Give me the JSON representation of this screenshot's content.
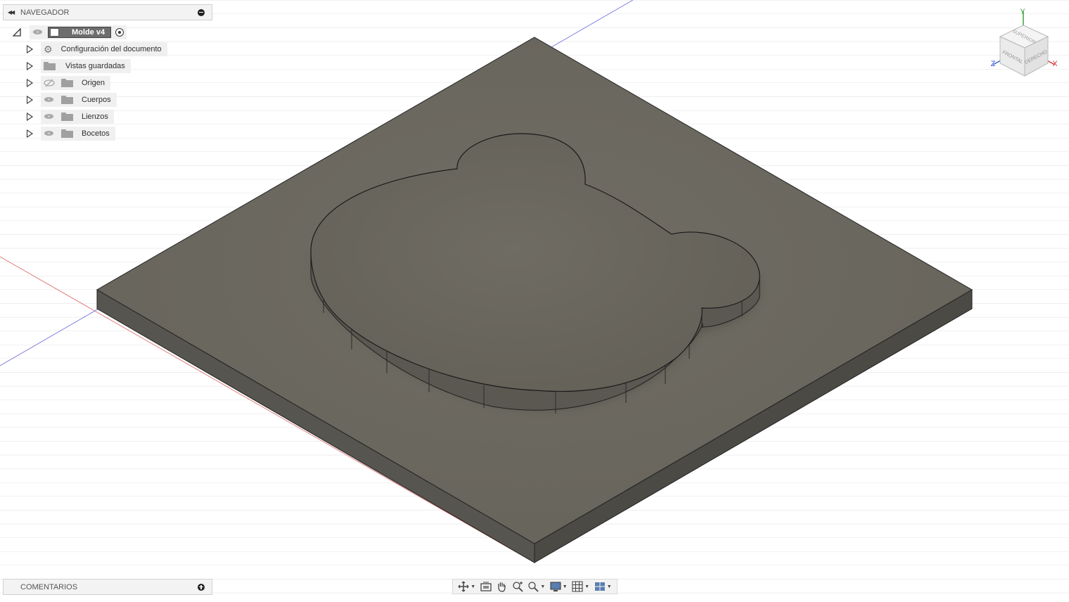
{
  "navigator": {
    "title": "NAVEGADOR",
    "root": {
      "label": "Molde v4"
    },
    "items": [
      {
        "label": "Configuración del documento",
        "icon": "gear-icon"
      },
      {
        "label": "Vistas guardadas",
        "icon": "folder-icon"
      },
      {
        "label": "Origen",
        "icon": "folder-icon",
        "visibility": "hidden"
      },
      {
        "label": "Cuerpos",
        "icon": "folder-icon",
        "visibility": "visible"
      },
      {
        "label": "Lienzos",
        "icon": "folder-icon",
        "visibility": "visible"
      },
      {
        "label": "Bocetos",
        "icon": "folder-icon",
        "visibility": "visible"
      }
    ]
  },
  "comments": {
    "title": "COMENTARIOS"
  },
  "viewcube": {
    "faces": {
      "top": "SUPERIOR",
      "front": "FRONTAL",
      "right": "DERECHO"
    },
    "axes": {
      "x": "X",
      "y": "Y",
      "z": "Z"
    }
  },
  "toolbar": {
    "buttons": [
      {
        "name": "orbit-icon",
        "has_menu": true
      },
      {
        "name": "look-at-icon",
        "has_menu": false
      },
      {
        "name": "pan-icon",
        "has_menu": false
      },
      {
        "name": "zoom-icon",
        "has_menu": false
      },
      {
        "name": "fit-icon",
        "has_menu": true
      },
      {
        "name": "display-settings-icon",
        "has_menu": true
      },
      {
        "name": "grid-icon",
        "has_menu": true
      },
      {
        "name": "viewports-icon",
        "has_menu": true
      }
    ]
  },
  "colors": {
    "body": "#6d6a60",
    "grid_minor": "#ececec",
    "grid_major": "#d9d9d9",
    "axis_x": "#e06060",
    "axis_z": "#6a6ae0"
  }
}
